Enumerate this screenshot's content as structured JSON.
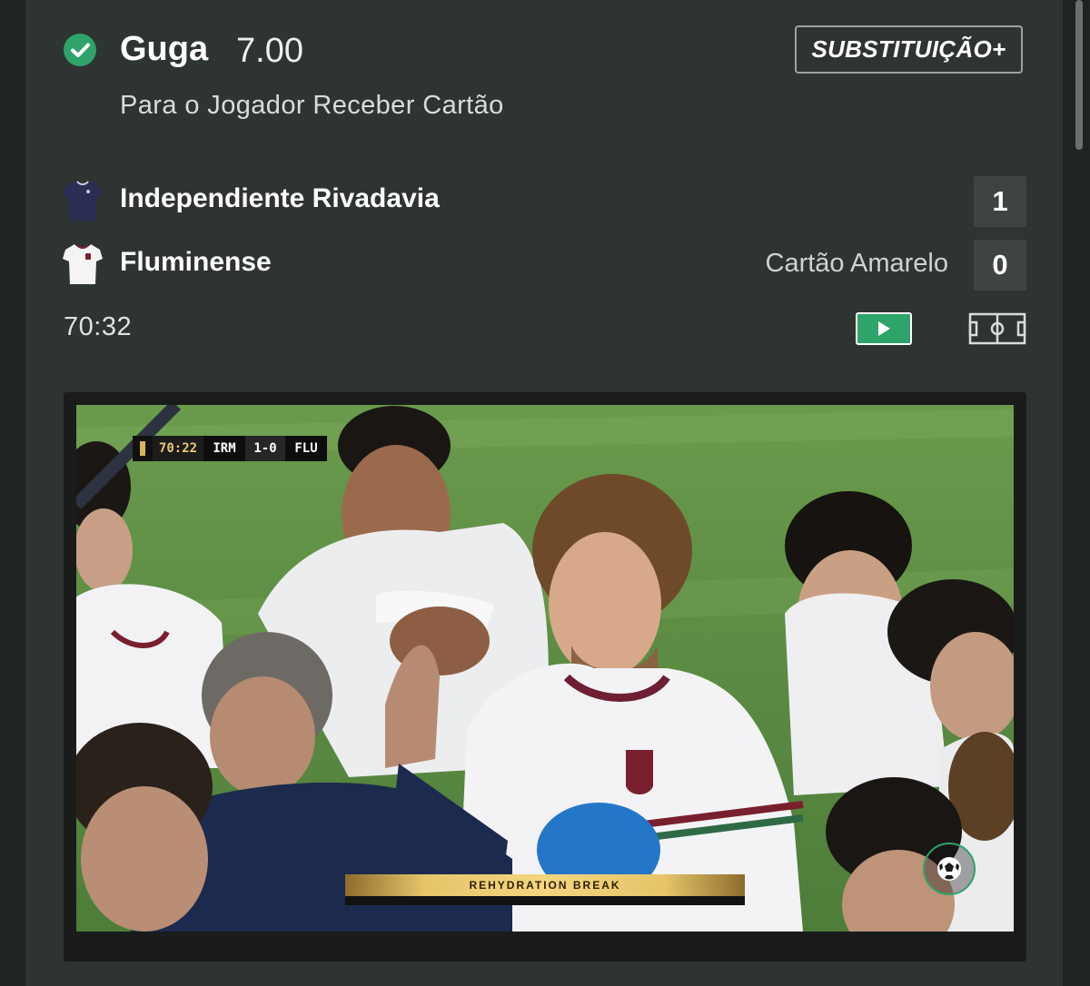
{
  "selection": {
    "name": "Guga",
    "odds": "7.00",
    "market": "Para o Jogador Receber Cartão",
    "substitution_label": "SUBSTITUIÇÃO+"
  },
  "match": {
    "home": {
      "name": "Independiente Rivadavia",
      "score": "1",
      "shirt_color": "#2b2d55"
    },
    "away": {
      "name": "Fluminense",
      "score": "0",
      "note": "Cartão Amarelo",
      "shirt_color": "#f4f4f4"
    },
    "clock": "70:32"
  },
  "video": {
    "scorebug": {
      "time": "70:22",
      "home": "IRM",
      "score": "1-0",
      "away": "FLU"
    },
    "banner": "REHYDRATION BREAK",
    "icons": [
      "play-icon",
      "pitch-icon",
      "football-icon",
      "check-icon"
    ]
  },
  "colors": {
    "accent_green": "#2ea36a",
    "background": "#2e3431"
  }
}
